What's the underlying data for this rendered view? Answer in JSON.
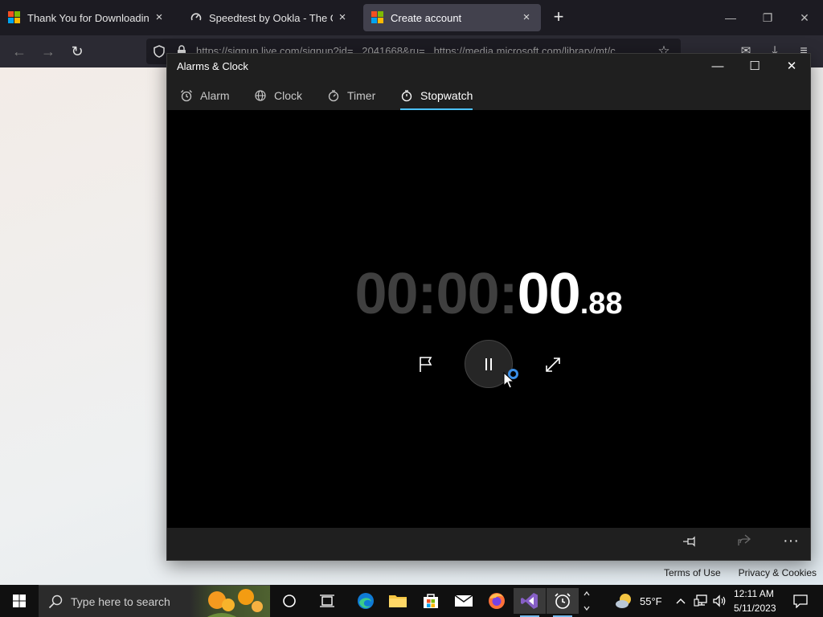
{
  "browser": {
    "tabs": [
      {
        "title": "Thank You for Downloading Vis",
        "active": false
      },
      {
        "title": "Speedtest by Ookla - The Globa",
        "active": false
      },
      {
        "title": "Create account",
        "active": true
      }
    ],
    "url": "https://signup.live.com/signup?id=...2041668&ru=...https://media.microsoft.com/library/mt/c",
    "footer_links": [
      "Terms of Use",
      "Privacy & Cookies"
    ]
  },
  "app": {
    "title": "Alarms & Clock",
    "tabs": [
      {
        "label": "Alarm",
        "icon": "alarm-icon",
        "active": false
      },
      {
        "label": "Clock",
        "icon": "globe-icon",
        "active": false
      },
      {
        "label": "Timer",
        "icon": "timer-icon",
        "active": false
      },
      {
        "label": "Stopwatch",
        "icon": "stopwatch-icon",
        "active": true
      }
    ],
    "stopwatch": {
      "hours": "00",
      "minutes": "00",
      "seconds": "00",
      "hundredths": ".88",
      "sep": ":"
    },
    "accent": "#4cc2ff"
  },
  "taskbar": {
    "search_placeholder": "Type here to search",
    "weather_temp": "55°F",
    "time": "12:11 AM",
    "date": "5/11/2023"
  }
}
